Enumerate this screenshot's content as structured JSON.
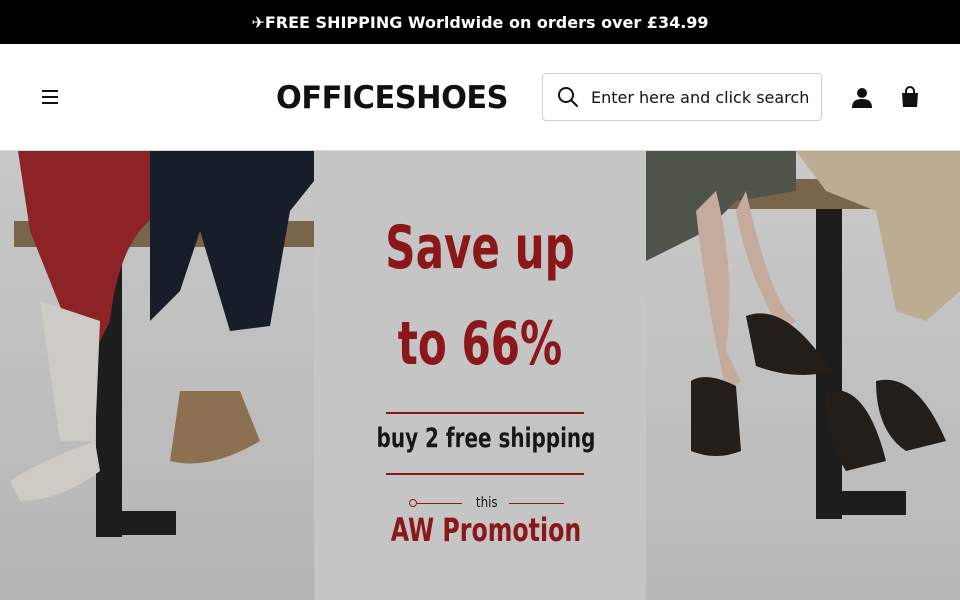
{
  "announcement": {
    "icon": "plane-icon",
    "text": "✈FREE SHIPPING Worldwide on orders over £34.99"
  },
  "header": {
    "logo": "OFFICESHOES",
    "menu_icon": "hamburger-menu-icon",
    "search": {
      "placeholder": "Enter here and click search",
      "icon": "search-icon"
    },
    "account_icon": "user-icon",
    "cart_icon": "shopping-bag-icon"
  },
  "hero": {
    "headline_line1": "Save up",
    "headline_line2": "to 66%",
    "subline": "buy 2 free shipping",
    "small_label": "this",
    "promotion": "AW Promotion",
    "colors": {
      "accent": "#9e1b1e",
      "text": "#1b1b1b",
      "bar": "#000000"
    }
  }
}
